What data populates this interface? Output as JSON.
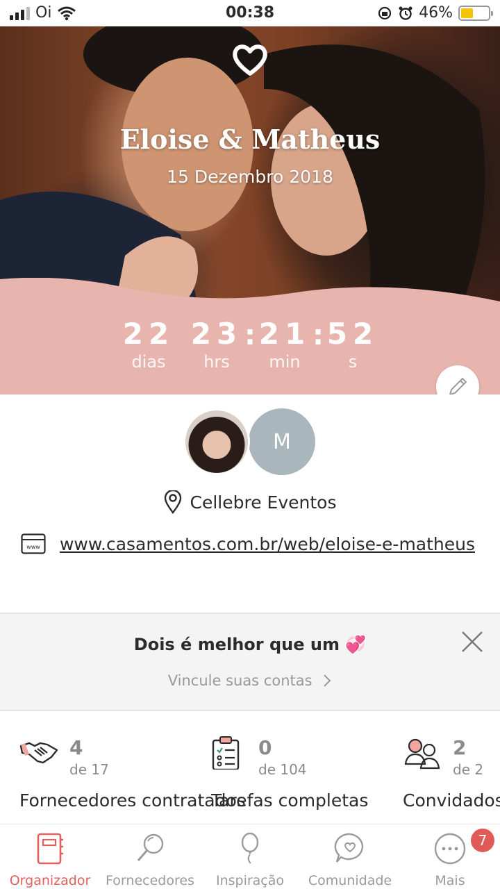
{
  "status_bar": {
    "carrier": "Oi",
    "time": "00:38",
    "battery_percent": "46%",
    "battery_level": 0.46,
    "battery_color": "#f5c400"
  },
  "hero": {
    "heart_icon": "heart-outline-icon",
    "couple_names": "Eloise & Matheus",
    "wedding_date": "15 Dezembro 2018",
    "band_color": "#e8b4ae",
    "countdown": {
      "days": "22",
      "days_unit": "dias",
      "hours": "23",
      "hours_unit": "hrs",
      "minutes": "21",
      "minutes_unit": "min",
      "seconds": "52",
      "seconds_unit": "s"
    },
    "edit_icon": "pencil-icon"
  },
  "profile": {
    "partner_initial": "M",
    "venue": "Cellebre Eventos",
    "website": "www.casamentos.com.br/web/eloise-e-matheus"
  },
  "promo": {
    "title": "Dois é melhor que um 💞",
    "link": "Vincule suas contas",
    "close_icon": "close-icon"
  },
  "stats": [
    {
      "icon": "handshake-icon",
      "count": "4",
      "total": "de 17",
      "label": "Fornecedores contratados"
    },
    {
      "icon": "clipboard-checklist-icon",
      "count": "0",
      "total": "de 104",
      "label": "Tarefas completas"
    },
    {
      "icon": "guests-icon",
      "count": "2",
      "total": "de 2",
      "label": "Convidados confirmados"
    }
  ],
  "tabbar": {
    "active_color": "#e0605b",
    "items": [
      {
        "label": "Organizador",
        "icon": "planner-book-icon"
      },
      {
        "label": "Fornecedores",
        "icon": "magnifier-icon"
      },
      {
        "label": "Inspiração",
        "icon": "balloon-icon"
      },
      {
        "label": "Comunidade",
        "icon": "chat-heart-icon"
      },
      {
        "label": "Mais",
        "icon": "more-dots-icon",
        "badge": "7"
      }
    ]
  }
}
